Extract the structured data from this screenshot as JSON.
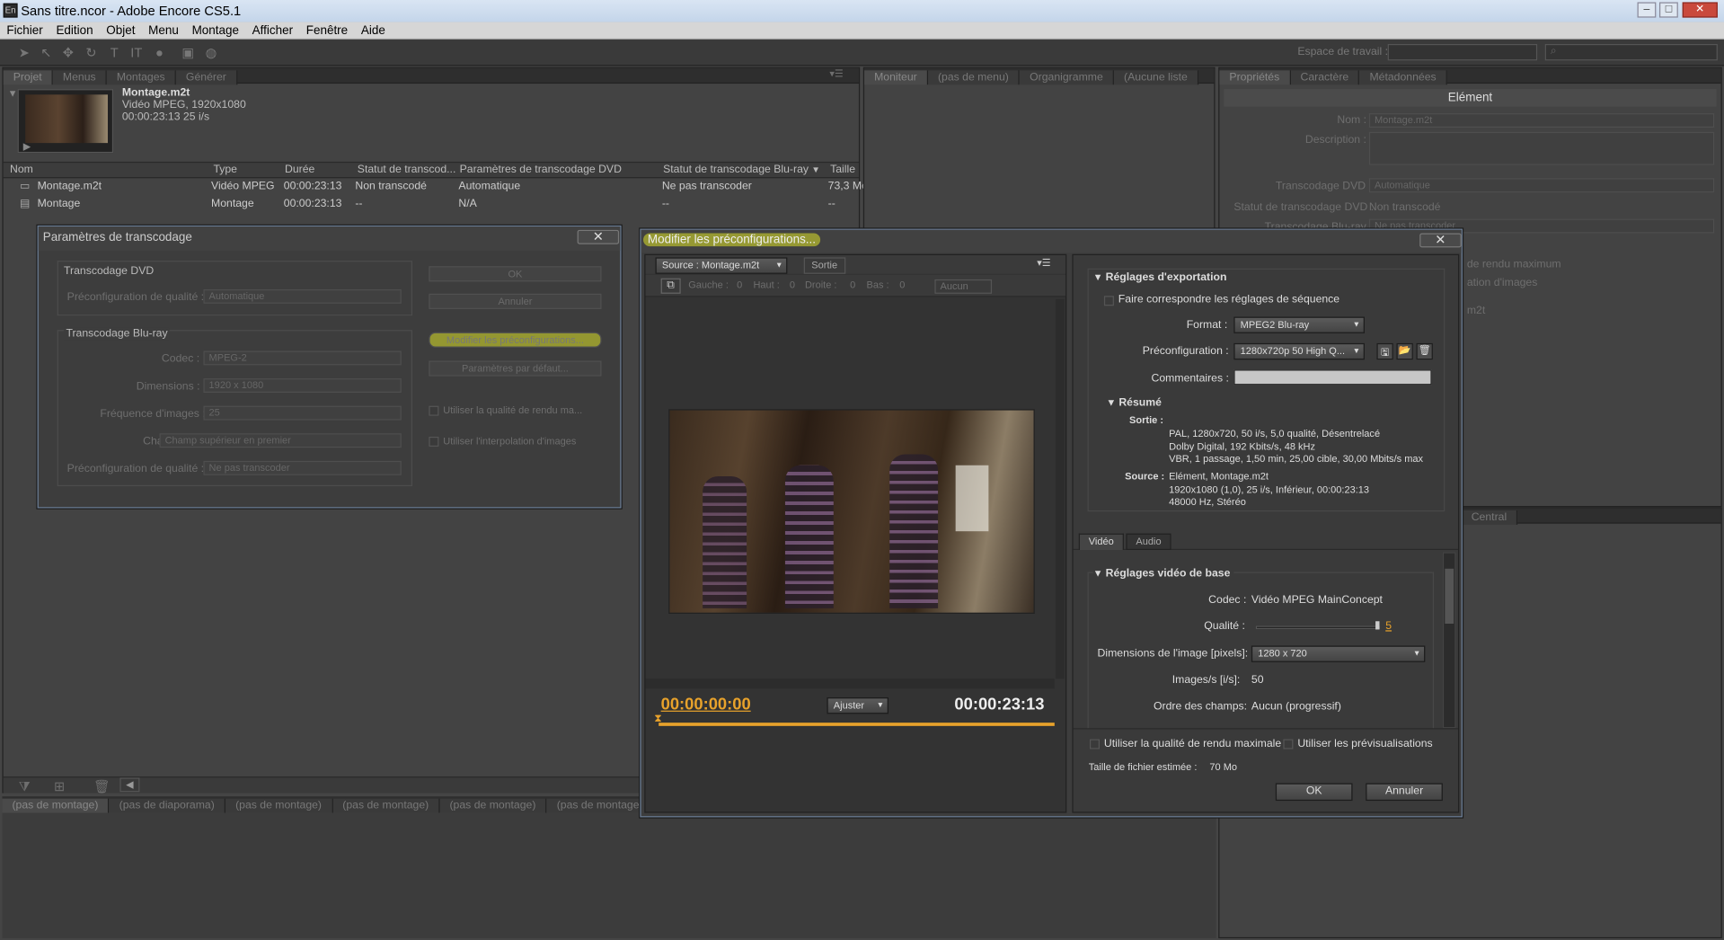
{
  "window": {
    "title": "Sans titre.ncor - Adobe Encore CS5.1",
    "app_icon": "En"
  },
  "menu": [
    "Fichier",
    "Edition",
    "Objet",
    "Menu",
    "Montage",
    "Afficher",
    "Fenêtre",
    "Aide"
  ],
  "toolbar": {
    "workspace_label": "Espace de travail :"
  },
  "project_panel": {
    "tabs": [
      "Projet",
      "Menus",
      "Montages",
      "Générer"
    ],
    "preview": {
      "name": "Montage.m2t",
      "line1": "Vidéo MPEG, 1920x1080",
      "line2": "00:00:23:13 25 i/s"
    },
    "columns": [
      "Nom",
      "Type",
      "Durée",
      "Statut de transcod...",
      "Paramètres de transcodage DVD",
      "Statut de transcodage Blu-ray",
      "Taille"
    ],
    "rows": [
      [
        "Montage.m2t",
        "Vidéo MPEG",
        "00:00:23:13",
        "Non transcodé",
        "Automatique",
        "Ne pas transcoder",
        "73,3 Mo"
      ],
      [
        "Montage",
        "Montage",
        "00:00:23:13",
        "--",
        "N/A",
        "--",
        "--"
      ]
    ]
  },
  "monitor_panel": {
    "tabs": [
      "Moniteur",
      "(pas de menu)",
      "Organigramme",
      "(Aucune liste"
    ]
  },
  "properties_panel": {
    "tabs": [
      "Propriétés",
      "Caractère",
      "Métadonnées"
    ],
    "title": "Elément",
    "nom_label": "Nom :",
    "nom_value": "Montage.m2t",
    "desc_label": "Description :",
    "dvd_label": "Transcodage DVD :",
    "dvd_value": "Automatique",
    "dvd_status_label": "Statut de transcodage DVD :",
    "dvd_status_value": "Non transcodé",
    "bluray_label": "Transcodage Blu-ray :",
    "bluray_value": "Ne pas transcoder",
    "hidden1": "de rendu maximum",
    "hidden2": "ation d'images",
    "hidden3": "m2t",
    "central_tab": "Central"
  },
  "timeline_tabs": [
    "(pas de montage)",
    "(pas de diaporama)",
    "(pas de montage)",
    "(pas de montage)",
    "(pas de montage)",
    "(pas de montage"
  ],
  "transcode_dialog": {
    "title": "Paramètres de transcodage",
    "dvd_group": "Transcodage DVD",
    "dvd_quality_label": "Préconfiguration de qualité :",
    "dvd_quality_value": "Automatique",
    "bluray_group": "Transcodage Blu-ray",
    "codec_label": "Codec :",
    "codec_value": "MPEG-2",
    "dims_label": "Dimensions :",
    "dims_value": "1920 x 1080",
    "fps_label": "Fréquence d'images :",
    "fps_value": "25",
    "fields_label": "Champs :",
    "fields_value": "Champ supérieur en premier",
    "bq_label": "Préconfiguration de qualité :",
    "bq_value": "Ne pas transcoder",
    "ok": "OK",
    "cancel": "Annuler",
    "modify": "Modifier les préconfigurations...",
    "defaults": "Paramètres par défaut...",
    "max_quality": "Utiliser la qualité de rendu ma...",
    "interp": "Utiliser l'interpolation d'images"
  },
  "preset_dialog": {
    "title": "Modifier les préconfigurations...",
    "source_tab": "Source : Montage.m2t",
    "output_tab": "Sortie",
    "crop": {
      "left_label": "Gauche :",
      "left": "0",
      "top_label": "Haut :",
      "top": "0",
      "right_label": "Droite :",
      "right": "0",
      "bottom_label": "Bas :",
      "bottom": "0",
      "ratio": "Aucun"
    },
    "tc_start": "00:00:00:00",
    "fit": "Ajuster",
    "tc_end": "00:00:23:13",
    "export_settings": "Réglages d'exportation",
    "match_seq": "Faire correspondre les réglages de séquence",
    "format_label": "Format :",
    "format_value": "MPEG2 Blu-ray",
    "preset_label": "Préconfiguration :",
    "preset_value": "1280x720p 50 High Q...",
    "comments_label": "Commentaires :",
    "summary": "Résumé",
    "output_label": "Sortie :",
    "output_lines": [
      "PAL, 1280x720, 50 i/s, 5,0 qualité, Désentrelacé",
      "Dolby Digital, 192 Kbits/s, 48 kHz",
      "VBR, 1 passage, 1,50 min, 25,00 cible, 30,00 Mbits/s max"
    ],
    "source_label": "Source :",
    "source_lines": [
      "Elément, Montage.m2t",
      "1920x1080 (1,0), 25 i/s, Inférieur, 00:00:23:13",
      "48000 Hz, Stéréo"
    ],
    "tabs": [
      "Vidéo",
      "Audio"
    ],
    "video_basic": "Réglages vidéo de base",
    "codec_label": "Codec :",
    "codec_value": "Vidéo MPEG MainConcept",
    "quality_label": "Qualité :",
    "quality_value": "5",
    "frame_label": "Dimensions de l'image [pixels]:",
    "frame_value": "1280 x 720",
    "fps_label": "Images/s [i/s]:",
    "fps_value": "50",
    "field_label": "Ordre des champs:",
    "field_value": "Aucun (progressif)",
    "max_render": "Utiliser la qualité de rendu maximale",
    "use_previews": "Utiliser les prévisualisations",
    "filesize_label": "Taille de fichier estimée :",
    "filesize_value": "70 Mo",
    "ok": "OK",
    "cancel": "Annuler"
  },
  "colors": {
    "accent": "#e8a22b",
    "highlight": "#dce128",
    "border_blue": "#6b7e96"
  }
}
